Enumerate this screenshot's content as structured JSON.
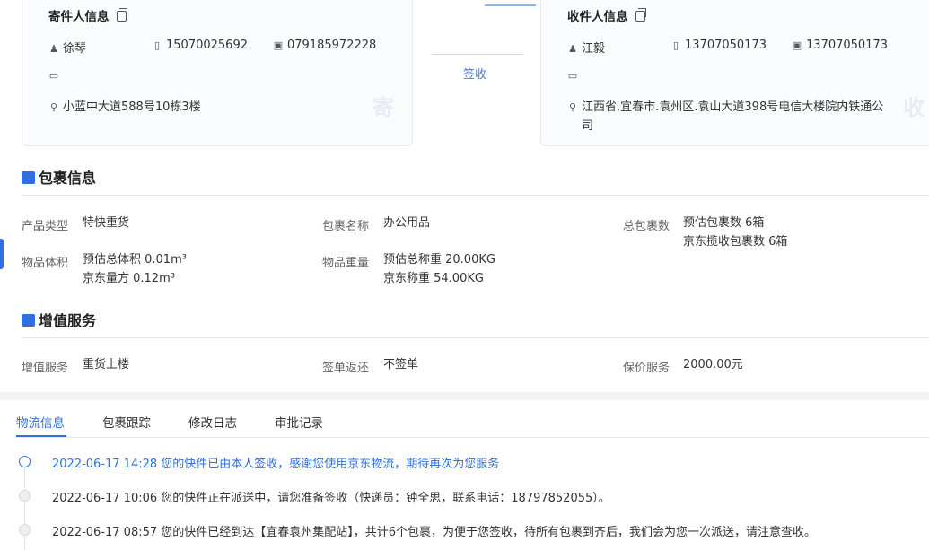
{
  "sender": {
    "title": "寄件人信息",
    "name": "徐琴",
    "mobile": "15070025692",
    "phone": "079185972228",
    "address": "小蓝中大道588号10栋3楼",
    "watermark": "寄"
  },
  "receiver": {
    "title": "收件人信息",
    "name": "江毅",
    "mobile": "13707050173",
    "phone": "13707050173",
    "address_line1": "江西省.宜春市.袁州区.袁山大道398号电信大楼院内铁通公",
    "address_line2": "司",
    "watermark": "收"
  },
  "connector_label": "签收",
  "package": {
    "title": "包裹信息",
    "product_type_label": "产品类型",
    "product_type": "特快重货",
    "package_name_label": "包裹名称",
    "package_name": "办公用品",
    "total_count_label": "总包裹数",
    "total_count_1": "预估包裹数 6箱",
    "total_count_2": "京东揽收包裹数 6箱",
    "volume_label": "物品体积",
    "volume_1": "预估总体积 0.01m³",
    "volume_2": "京东量方 0.12m³",
    "weight_label": "物品重量",
    "weight_1": "预估总称重 20.00KG",
    "weight_2": "京东称重 54.00KG"
  },
  "value_added": {
    "title": "增值服务",
    "service_label": "增值服务",
    "service": "重货上楼",
    "receipt_label": "签单返还",
    "receipt": "不签单",
    "insurance_label": "保价服务",
    "insurance": "2000.00元"
  },
  "tabs": [
    "物流信息",
    "包裹跟踪",
    "修改日志",
    "审批记录"
  ],
  "timeline": [
    "2022-06-17 14:28  您的快件已由本人签收，感谢您使用京东物流，期待再次为您服务",
    "2022-06-17 10:06  您的快件正在派送中，请您准备签收（快递员：钟全思，联系电话：18797852055）。",
    "2022-06-17 08:57  您的快件已经到达【宜春袁州集配站】，共计6个包裹，为便于您签收，待所有包裹到齐后，我们会为您一次派送，请注意查收。"
  ],
  "colors": {
    "accent": "#2f6fe0"
  }
}
